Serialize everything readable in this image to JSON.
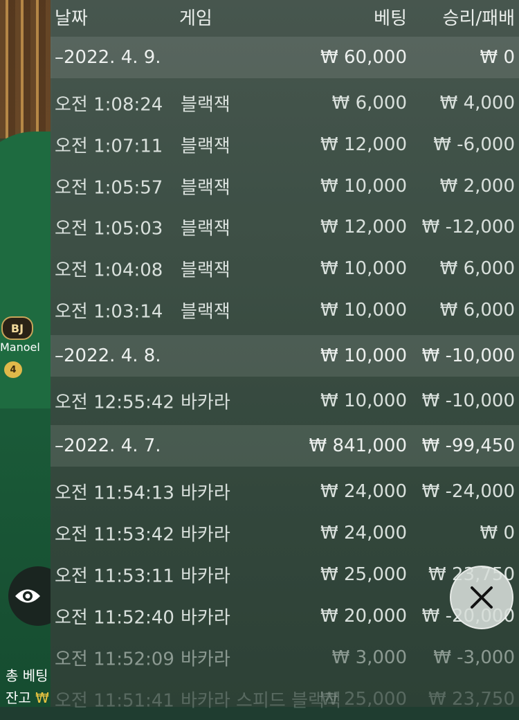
{
  "header": {
    "date": "날짜",
    "game": "게임",
    "bet": "베팅",
    "result": "승리/패배"
  },
  "groups": [
    {
      "date": "–2022. 4. 9.",
      "bet": "₩ 60,000",
      "result": "₩ 0"
    },
    {
      "date": "–2022. 4. 8.",
      "bet": "₩ 10,000",
      "result": "₩ -10,000"
    },
    {
      "date": "–2022. 4. 7.",
      "bet": "₩ 841,000",
      "result": "₩ -99,450"
    }
  ],
  "entries": [
    {
      "time": "오전 1:08:24",
      "game": "블랙잭",
      "bet": "₩ 6,000",
      "result": "₩ 4,000"
    },
    {
      "time": "오전 1:07:11",
      "game": "블랙잭",
      "bet": "₩ 12,000",
      "result": "₩ -6,000"
    },
    {
      "time": "오전 1:05:57",
      "game": "블랙잭",
      "bet": "₩ 10,000",
      "result": "₩ 2,000"
    },
    {
      "time": "오전 1:05:03",
      "game": "블랙잭",
      "bet": "₩ 12,000",
      "result": "₩ -12,000"
    },
    {
      "time": "오전 1:04:08",
      "game": "블랙잭",
      "bet": "₩ 10,000",
      "result": "₩ 6,000"
    },
    {
      "time": "오전 1:03:14",
      "game": "블랙잭",
      "bet": "₩ 10,000",
      "result": "₩ 6,000"
    },
    {
      "time": "오전 12:55:42",
      "game": "바카라",
      "bet": "₩ 10,000",
      "result": "₩ -10,000"
    },
    {
      "time": "오전 11:54:13",
      "game": "바카라",
      "bet": "₩ 24,000",
      "result": "₩ -24,000"
    },
    {
      "time": "오전 11:53:42",
      "game": "바카라",
      "bet": "₩ 24,000",
      "result": "₩ 0"
    },
    {
      "time": "오전 11:53:11",
      "game": "바카라",
      "bet": "₩ 25,000",
      "result": "₩ 23,750"
    },
    {
      "time": "오전 11:52:40",
      "game": "바카라",
      "bet": "₩ 20,000",
      "result": "₩ -20,000"
    },
    {
      "time": "오전 11:52:09",
      "game": "바카라",
      "bet": "₩ 3,000",
      "result": "₩ -3,000"
    },
    {
      "time": "오전 11:51:41",
      "game": "바카라 스피드 블랙잭",
      "bet": "₩ 25,000",
      "result": "₩ 23,750"
    }
  ],
  "background": {
    "badge": "BJ",
    "player_name": "Manoel",
    "medal_level": "4",
    "total_bet_label": "총 베팅",
    "balance_label": "잔고",
    "balance_currency": "₩"
  },
  "icons": {
    "close": "close-icon",
    "eye": "eye-icon"
  },
  "colors": {
    "panel": "#3e5046",
    "group_row": "#56635b",
    "table_felt": "#1e6b40"
  }
}
